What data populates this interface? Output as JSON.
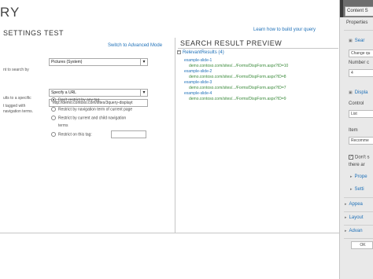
{
  "dialog": {
    "title": "RY",
    "tabs": [
      "SETTINGS",
      "TEST"
    ],
    "advanced_link": "Switch to Advanced Mode",
    "learn_link": "Learn how to build your query"
  },
  "form": {
    "source_label_1": "nt to search by",
    "source_value": "Pictures (System)",
    "restrict_label_1": "ults to a specific",
    "restrict_select": "Specify a URL",
    "restrict_url": "\"http://demo.contoso.com/sites/3query-displayt",
    "tag_label_1": "t tagged with",
    "tag_label_2": "navigation terms.",
    "radio_options": [
      "Don't restrict by any tag",
      "Restrict by navigation term of current page",
      "Restrict by current and child navigation",
      "terms",
      "Restrict on this tag:"
    ]
  },
  "preview": {
    "title": "SEARCH RESULT PREVIEW",
    "root": "RelevantResults (4)",
    "root_toggle": "−",
    "results": [
      {
        "title": "example-slide-1",
        "url": "demo.contoso.com/sites/.../Forms/DispForm.aspx?ID=10"
      },
      {
        "title": "example-slide-2",
        "url": "demo.contoso.com/sites/.../Forms/DispForm.aspx?ID=8"
      },
      {
        "title": "example-slide-3",
        "url": "demo.contoso.com/sites/.../Forms/DispForm.aspx?ID=7"
      },
      {
        "title": "example-slide-4",
        "url": "demo.contoso.com/sites/.../Forms/DispForm.aspx?ID=9"
      }
    ]
  },
  "side_panel": {
    "tab": "Content S",
    "properties": "Properties",
    "search_section": "Sear",
    "change_btn": "Change qu",
    "number_label": "Number c",
    "number_value": "4",
    "display_section": "Displa",
    "control_label": "Control",
    "control_value": "List",
    "item_label": "Item",
    "item_value": "Recomme",
    "dont_label": "Don't s",
    "there_label": "there ar",
    "property_label": "Prope",
    "settings_label": "Setti",
    "appearance": "Appea",
    "layout": "Layout",
    "advanced": "Advan",
    "ok": "OK"
  }
}
